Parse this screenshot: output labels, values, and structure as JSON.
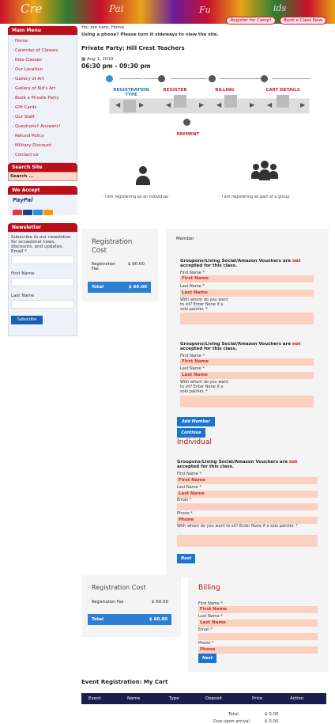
{
  "banner": {
    "words": [
      "Cre",
      "Pai",
      "Fu",
      "ids"
    ],
    "register_btn": "Register for Camp!",
    "book_btn": "Book a Class Now"
  },
  "sidebar": {
    "main_menu_title": "Main Menu",
    "items": [
      "Home",
      "Calendar of Classes",
      "Kids Classes",
      "Our Location",
      "Gallery of Art",
      "Gallery of Kid's Art",
      "Book a Private Party",
      "Gift Cards",
      "Our Staff",
      "Questions? Answers!",
      "Refund Policy",
      "Military Discount",
      "Contact us"
    ],
    "search_title": "Search Site",
    "search_placeholder": "Search ...",
    "accept_title": "We Accept",
    "paypal": "PayPal",
    "newsletter_title": "Newsletter",
    "newsletter_text": "Subscribe to our newsletter for occasional news, discounts, and updates.",
    "email_label": "Email *",
    "first_label": "First Name",
    "last_label": "Last Name",
    "subscribe": "Subscribe"
  },
  "breadcrumb": {
    "prefix": "You are here:",
    "current": "Home"
  },
  "phone_note": "Using a phone? Please turn it sideways to view the site.",
  "event": {
    "title": "Private Party: Hill Crest Teachers",
    "date": "Aug 1, 2019",
    "time": "06:30 pm - 09:30 pm"
  },
  "steps": {
    "s1": "REGISTRATION TYPE",
    "s2": "REGISTER",
    "s3": "BILLING",
    "s4": "CART DETAILS",
    "s5": "PAYMENT"
  },
  "regtype": {
    "individual": "I am registering as an individual",
    "group": "I am registering as part of a group"
  },
  "cost1": {
    "title": "Registration Cost",
    "fee_label": "Registration Fee",
    "fee": "$ 60.00",
    "total_label": "Total",
    "total": "$ 60.00"
  },
  "member": {
    "label": "Member",
    "warn_a": "Groupons/Living Social/Amazon Vouchers are",
    "warn_not": "not",
    "warn_b": "accepted for this class.",
    "first_label": "First Name *",
    "first_ph": "First Name",
    "last_label": "Last Name *",
    "last_ph": "Last Name",
    "sit_label": "With whom do you want to sit? Enter None if a solo painter.  *",
    "add_member": "Add Member",
    "continue": "Continue"
  },
  "individual": {
    "title": "Individual",
    "warn_a": "Groupons/Living Social/Amazon Vouchers are",
    "warn_not": "not",
    "warn_b": "accepted for this class.",
    "first_label": "First Name *",
    "first_ph": "First Name",
    "last_label": "Last Name *",
    "last_ph": "Last Name",
    "email_label": "Email *",
    "phone_label": "Phone *",
    "phone_ph": "Phone",
    "sit_label": "With whom do you want to sit? Enter None if a solo painter.  *",
    "next": "Next"
  },
  "cost2": {
    "title": "Registration Cost",
    "fee_label": "Registration Fee",
    "fee": "$ 60.00",
    "total_label": "Total",
    "total": "$ 60.00"
  },
  "billing": {
    "title": "Billing",
    "first_label": "First Name *",
    "first_ph": "First Name",
    "last_label": "Last Name *",
    "last_ph": "Last Name",
    "email_label": "Email *",
    "phone_label": "Phone *",
    "phone_ph": "Phone",
    "next": "Next"
  },
  "cart": {
    "title": "Event Registration: My Cart",
    "cols": [
      "Event",
      "Name",
      "Type",
      "Deposit",
      "Price",
      "Action"
    ],
    "total_label": "Total",
    "total": "$ 0.00",
    "due_label": "Due upon arrival",
    "due": "$ 0.00"
  },
  "colors": {
    "brand_red": "#b80f18",
    "accent_blue": "#2d7fd1",
    "navy": "#1b1d4d"
  }
}
